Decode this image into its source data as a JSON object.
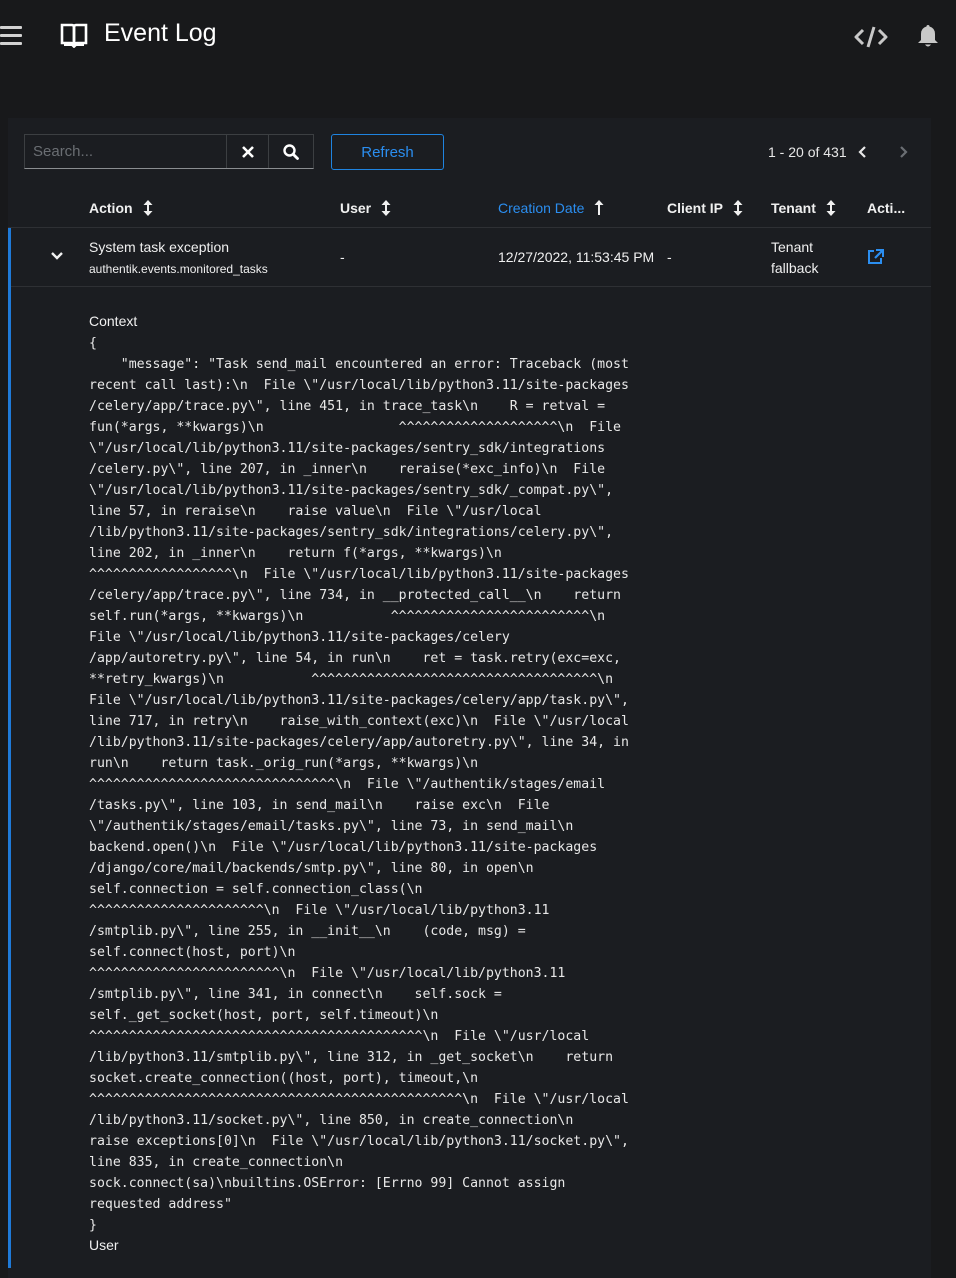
{
  "header": {
    "title": "Event Log",
    "icons": [
      "menu-icon",
      "book-icon",
      "code-icon",
      "bell-icon"
    ]
  },
  "toolbar": {
    "search_placeholder": "Search...",
    "search_value": "",
    "refresh_label": "Refresh",
    "pagination": "1 - 20 of 431"
  },
  "table": {
    "columns": [
      {
        "label": "Action",
        "sort": "sortable"
      },
      {
        "label": "User",
        "sort": "sortable"
      },
      {
        "label": "Creation Date",
        "sort": "ascending"
      },
      {
        "label": "Client IP",
        "sort": "sortable"
      },
      {
        "label": "Tenant",
        "sort": "sortable"
      },
      {
        "label": "Acti..."
      }
    ],
    "rows": [
      {
        "action": "System task exception",
        "app": "authentik.events.monitored_tasks",
        "user": "-",
        "created": "12/27/2022, 11:53:45 PM",
        "client_ip": "-",
        "tenant_line1": "Tenant",
        "tenant_line2": "fallback",
        "expanded": true
      }
    ]
  },
  "details": {
    "context_label": "Context",
    "context_json": "{\n    \"message\": \"Task send_mail encountered an error: Traceback (most\nrecent call last):\\n  File \\\"/usr/local/lib/python3.11/site-packages\n/celery/app/trace.py\\\", line 451, in trace_task\\n    R = retval =\nfun(*args, **kwargs)\\n                 ^^^^^^^^^^^^^^^^^^^^\\n  File\n\\\"/usr/local/lib/python3.11/site-packages/sentry_sdk/integrations\n/celery.py\\\", line 207, in _inner\\n    reraise(*exc_info)\\n  File\n\\\"/usr/local/lib/python3.11/site-packages/sentry_sdk/_compat.py\\\",\nline 57, in reraise\\n    raise value\\n  File \\\"/usr/local\n/lib/python3.11/site-packages/sentry_sdk/integrations/celery.py\\\",\nline 202, in _inner\\n    return f(*args, **kwargs)\\n\n^^^^^^^^^^^^^^^^^^\\n  File \\\"/usr/local/lib/python3.11/site-packages\n/celery/app/trace.py\\\", line 734, in __protected_call__\\n    return\nself.run(*args, **kwargs)\\n           ^^^^^^^^^^^^^^^^^^^^^^^^^\\n\nFile \\\"/usr/local/lib/python3.11/site-packages/celery\n/app/autoretry.py\\\", line 54, in run\\n    ret = task.retry(exc=exc,\n**retry_kwargs)\\n           ^^^^^^^^^^^^^^^^^^^^^^^^^^^^^^^^^^^^\\n\nFile \\\"/usr/local/lib/python3.11/site-packages/celery/app/task.py\\\",\nline 717, in retry\\n    raise_with_context(exc)\\n  File \\\"/usr/local\n/lib/python3.11/site-packages/celery/app/autoretry.py\\\", line 34, in\nrun\\n    return task._orig_run(*args, **kwargs)\\n\n^^^^^^^^^^^^^^^^^^^^^^^^^^^^^^^\\n  File \\\"/authentik/stages/email\n/tasks.py\\\", line 103, in send_mail\\n    raise exc\\n  File\n\\\"/authentik/stages/email/tasks.py\\\", line 73, in send_mail\\n\nbackend.open()\\n  File \\\"/usr/local/lib/python3.11/site-packages\n/django/core/mail/backends/smtp.py\\\", line 80, in open\\n\nself.connection = self.connection_class(\\n\n^^^^^^^^^^^^^^^^^^^^^^\\n  File \\\"/usr/local/lib/python3.11\n/smtplib.py\\\", line 255, in __init__\\n    (code, msg) =\nself.connect(host, port)\\n\n^^^^^^^^^^^^^^^^^^^^^^^^\\n  File \\\"/usr/local/lib/python3.11\n/smtplib.py\\\", line 341, in connect\\n    self.sock =\nself._get_socket(host, port, self.timeout)\\n\n^^^^^^^^^^^^^^^^^^^^^^^^^^^^^^^^^^^^^^^^^^\\n  File \\\"/usr/local\n/lib/python3.11/smtplib.py\\\", line 312, in _get_socket\\n    return\nsocket.create_connection((host, port), timeout,\\n\n^^^^^^^^^^^^^^^^^^^^^^^^^^^^^^^^^^^^^^^^^^^^^^^\\n  File \\\"/usr/local\n/lib/python3.11/socket.py\\\", line 850, in create_connection\\n\nraise exceptions[0]\\n  File \\\"/usr/local/lib/python3.11/socket.py\\\",\nline 835, in create_connection\\n\nsock.connect(sa)\\nbuiltins.OSError: [Errno 99] Cannot assign\nrequested address\"\n}",
    "user_label": "User"
  },
  "colors": {
    "background": "#18191b",
    "card": "#1b1d21",
    "accent": "#2b8ef0",
    "text": "#e8e8e8"
  }
}
